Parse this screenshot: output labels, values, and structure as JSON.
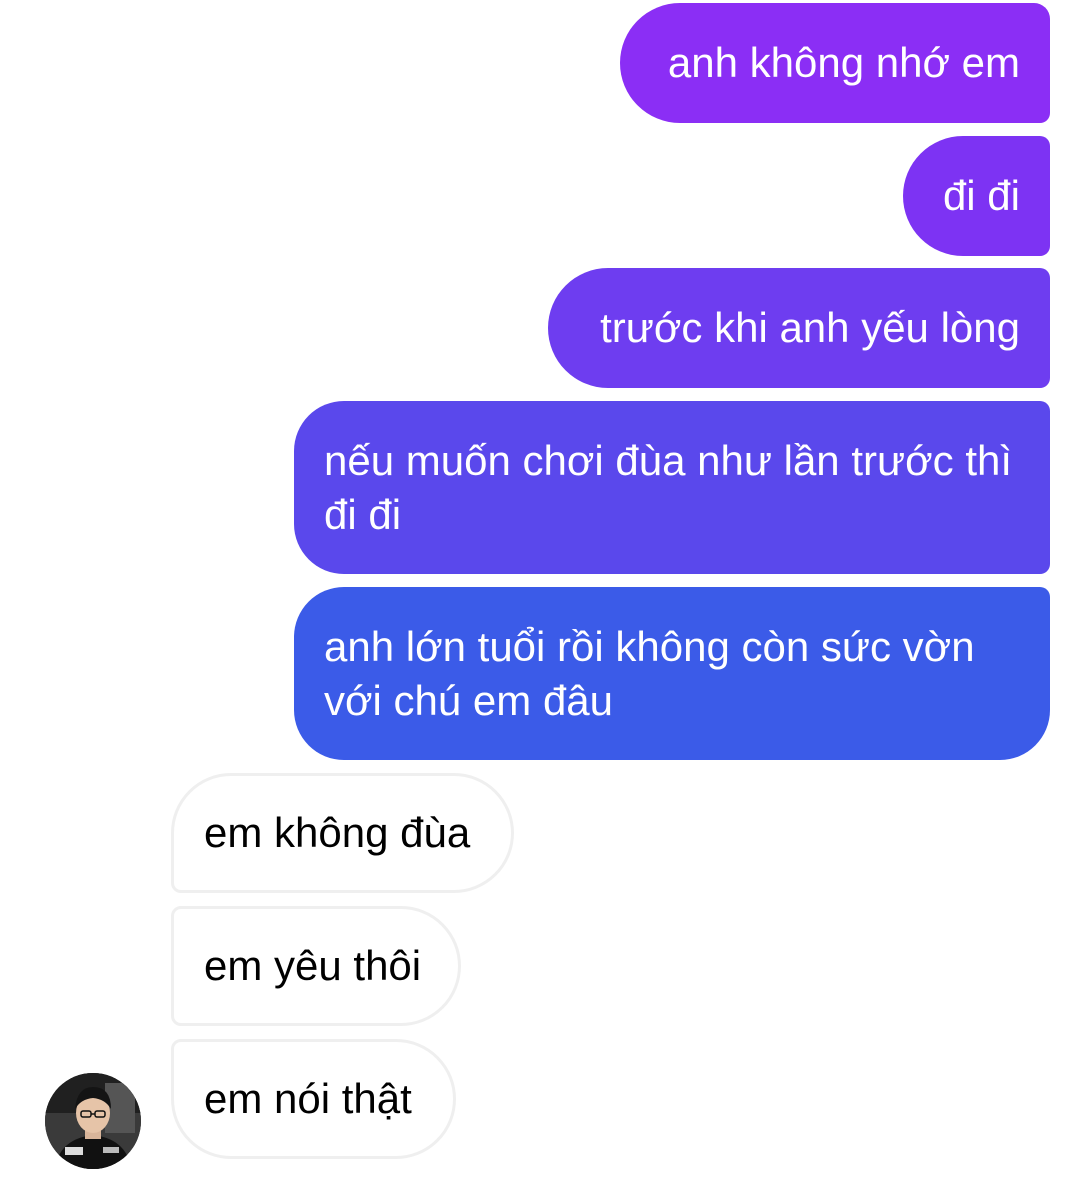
{
  "chat": {
    "sent": [
      {
        "text": "anh không nhớ em"
      },
      {
        "text": "đi đi"
      },
      {
        "text": "trước khi anh yếu lòng"
      },
      {
        "text": "nếu muốn chơi đùa như lần trước thì đi đi"
      },
      {
        "text": "anh lớn tuổi rồi không còn sức vờn với chú em đâu"
      }
    ],
    "received": [
      {
        "text": "em không đùa"
      },
      {
        "text": "em yêu thôi"
      },
      {
        "text": "em nói thật"
      }
    ],
    "colors": {
      "sent_gradient_top": "#8b2ef5",
      "sent_gradient_bottom": "#3b5be8",
      "received_bg": "#ffffff",
      "received_border": "#efefef"
    },
    "avatar_icon": "contact-avatar-photo"
  }
}
